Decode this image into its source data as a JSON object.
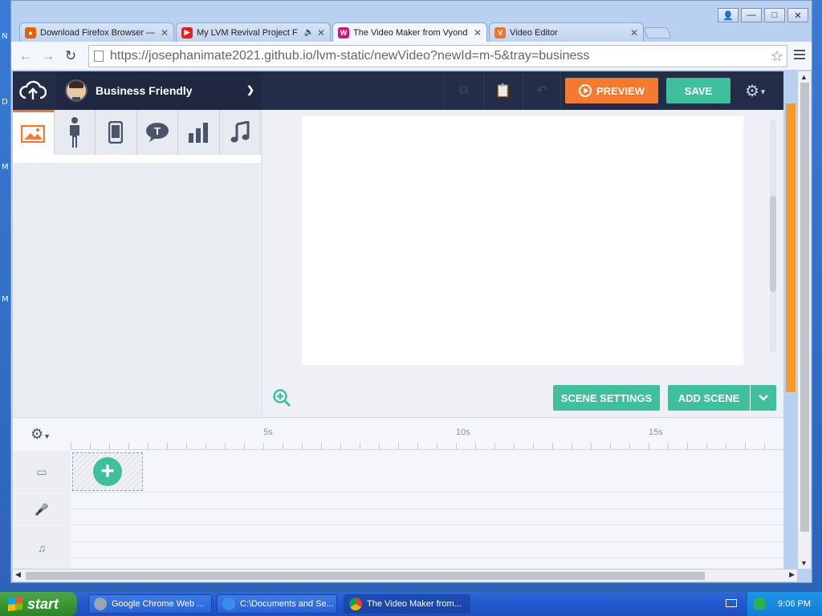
{
  "desktop": {
    "letters": [
      "N",
      "D",
      "M",
      "M"
    ]
  },
  "window": {
    "controls": {
      "user": "👤",
      "minimize": "—",
      "maximize": "□",
      "close": "✕"
    }
  },
  "tabs": [
    {
      "title": "Download Firefox Browser —",
      "icon": "firefox-icon",
      "color": "#e66000"
    },
    {
      "title": "My LVM Revival Project F",
      "icon": "youtube-icon",
      "color": "#e62117"
    },
    {
      "title": "The Video Maker from Vyond",
      "icon": "vyond-icon",
      "color": "#c9187e"
    },
    {
      "title": "Video Editor",
      "icon": "video-editor-icon",
      "color": "#e8762b"
    }
  ],
  "browser": {
    "url": "https://josephanimate2021.github.io/lvm-static/newVideo?newId=m-5&tray=business",
    "back": "←",
    "forward": "→",
    "reload": "↻",
    "star": "☆"
  },
  "app": {
    "theme": "Business Friendly",
    "preview_label": "PREVIEW",
    "save_label": "SAVE",
    "scene_settings_label": "SCENE SETTINGS",
    "add_scene_label": "ADD SCENE",
    "accent": "#3fbf9b",
    "preview_color": "#f47a32",
    "asset_tabs": [
      {
        "name": "tab-backgrounds",
        "glyph": "🖼"
      },
      {
        "name": "tab-characters",
        "glyph": "🕴"
      },
      {
        "name": "tab-props",
        "glyph": "📱"
      },
      {
        "name": "tab-text",
        "glyph": "💬"
      },
      {
        "name": "tab-charts",
        "glyph": "📊"
      },
      {
        "name": "tab-sound",
        "glyph": "♫"
      }
    ]
  },
  "timeline": {
    "labels": [
      "5s",
      "10s",
      "15s"
    ],
    "tracks": [
      {
        "icon": "camera-icon",
        "glyph": "▭"
      },
      {
        "icon": "microphone-icon",
        "glyph": "🎤"
      },
      {
        "icon": "music-icon",
        "glyph": "♫"
      }
    ]
  },
  "taskbar": {
    "start_label": "start",
    "tasks": [
      "Google Chrome Web ...",
      "C:\\Documents and Se...",
      "The Video Maker from..."
    ],
    "time": "9:06 PM"
  }
}
